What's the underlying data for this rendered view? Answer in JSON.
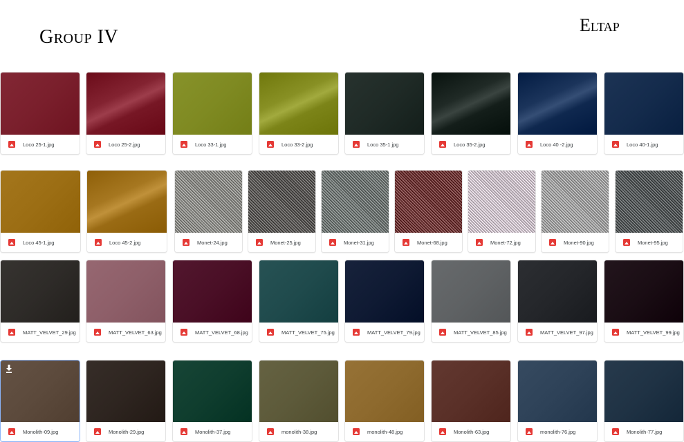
{
  "header": {
    "group_title": "Group IV",
    "brand": "Eltap"
  },
  "icons": {
    "file": "image-file-icon",
    "download": "download-icon",
    "file_icon_color": "#e53935"
  },
  "rows": [
    {
      "variant": "solid",
      "items": [
        {
          "name": "Loco 25-1.jpg",
          "color": "#7a1f2c",
          "sheen": false
        },
        {
          "name": "Loco 25-2.jpg",
          "color": "#7d1d2b",
          "sheen": true
        },
        {
          "name": "Loco 33-1.jpg",
          "color": "#7f8a22",
          "sheen": false
        },
        {
          "name": "Loco 33-2.jpg",
          "color": "#828a1e",
          "sheen": true
        },
        {
          "name": "Loco 35-1.jpg",
          "color": "#1f2a26",
          "sheen": false
        },
        {
          "name": "Loco 35-2.jpg",
          "color": "#1a2420",
          "sheen": true
        },
        {
          "name": "Loco 40 -2.jpg",
          "color": "#152e55",
          "sheen": true
        },
        {
          "name": "Loco 40-1.jpg",
          "color": "#142b4c",
          "sheen": false
        }
      ]
    },
    {
      "variant": "mixed",
      "items": [
        {
          "name": "Loco 45-1.jpg",
          "color": "#9c6e14",
          "sheen": false
        },
        {
          "name": "Loco 45-2.jpg",
          "color": "#a0711a",
          "sheen": true
        },
        {
          "name": "Monet-24.jpg",
          "color": "#8a8a86",
          "weave": true
        },
        {
          "name": "Monet-25.jpg",
          "color": "#5a5856",
          "weave": true
        },
        {
          "name": "Monet-31.jpg",
          "color": "#6f7573",
          "weave": true
        },
        {
          "name": "Monet-68.jpg",
          "color": "#6e3a3a",
          "weave": true
        },
        {
          "name": "Monet-72.jpg",
          "color": "#c6bcc4",
          "weave": true
        },
        {
          "name": "Monet-90.jpg",
          "color": "#9d9d9d",
          "weave": true
        },
        {
          "name": "Monet-95.jpg",
          "color": "#55595a",
          "weave": true
        }
      ]
    },
    {
      "variant": "solid",
      "items": [
        {
          "name": "MATT_VELVET_29.jpg",
          "color": "#2e2b28"
        },
        {
          "name": "MATT_VELVET_63.jpg",
          "color": "#8e5f69"
        },
        {
          "name": "MATT_VELVET_68.jpg",
          "color": "#4a0f26"
        },
        {
          "name": "MATT_VELVET_75.jpg",
          "color": "#1f4a4c"
        },
        {
          "name": "MATT_VELVET_79.jpg",
          "color": "#0f1a33"
        },
        {
          "name": "MATT_VELVET_85.jpg",
          "color": "#5f6264"
        },
        {
          "name": "MATT_VELVET_97.jpg",
          "color": "#24262a"
        },
        {
          "name": "MATT_VELVET_99.jpg",
          "color": "#1a0d14"
        }
      ]
    },
    {
      "variant": "solid",
      "items": [
        {
          "name": "Monolith-09.jpg",
          "color": "#5c4a3c",
          "selected": true
        },
        {
          "name": "Monolith-29.jpg",
          "color": "#2e2520"
        },
        {
          "name": "Monolith-37.jpg",
          "color": "#0f3d2e"
        },
        {
          "name": "monolith-38.jpg",
          "color": "#5d5a3a"
        },
        {
          "name": "monolith-48.jpg",
          "color": "#8e6a2e"
        },
        {
          "name": "Monolith-63.jpg",
          "color": "#5a3028"
        },
        {
          "name": "monolith-76.jpg",
          "color": "#2e4258"
        },
        {
          "name": "Monolith-77.jpg",
          "color": "#1f3244"
        }
      ]
    }
  ]
}
